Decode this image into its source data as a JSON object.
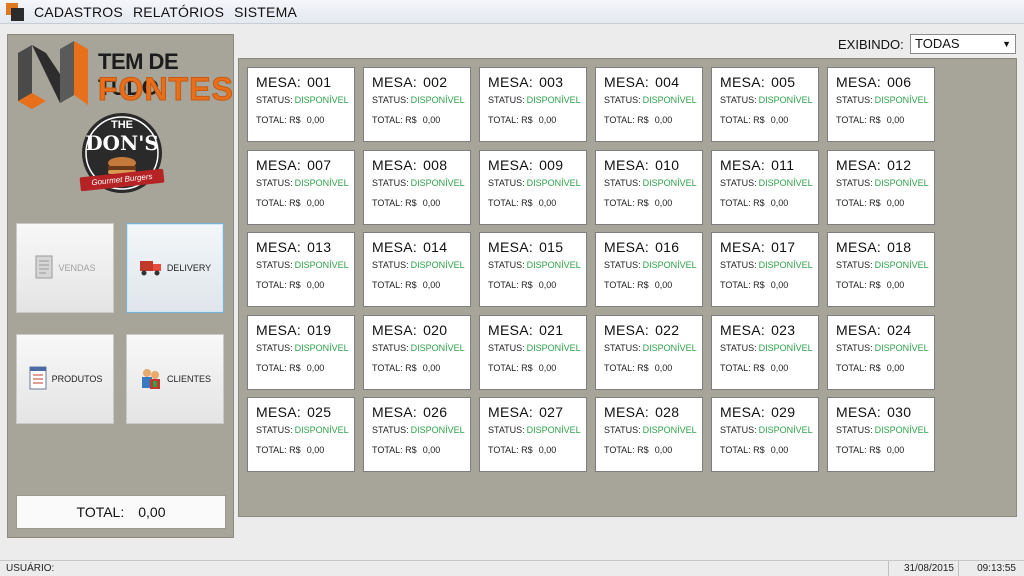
{
  "menu": {
    "items": [
      "CADASTROS",
      "RELATÓRIOS",
      "SISTEMA"
    ]
  },
  "brand": {
    "logo_line1": "TEM DE TUDO",
    "logo_line2": "FONTES",
    "badge_the": "THE",
    "badge_name": "DON'S",
    "badge_tagline": "Gourmet Burgers"
  },
  "sidebar": {
    "buttons": [
      {
        "label": "VENDAS",
        "icon": "document-icon",
        "state": "disabled"
      },
      {
        "label": "DELIVERY",
        "icon": "truck-icon",
        "state": "active"
      },
      {
        "label": "PRODUTOS",
        "icon": "list-icon",
        "state": "normal"
      },
      {
        "label": "CLIENTES",
        "icon": "people-icon",
        "state": "normal"
      }
    ],
    "total_label": "TOTAL:",
    "total_value": "0,00"
  },
  "filter": {
    "label": "EXIBINDO:",
    "selected": "TODAS"
  },
  "mesa_labels": {
    "prefix": "MESA:",
    "status_label": "STATUS:",
    "total_label": "TOTAL: R$"
  },
  "mesas": [
    {
      "numero": "001",
      "status": "DISPONÍVEL",
      "total": "0,00"
    },
    {
      "numero": "002",
      "status": "DISPONÍVEL",
      "total": "0,00"
    },
    {
      "numero": "003",
      "status": "DISPONÍVEL",
      "total": "0,00"
    },
    {
      "numero": "004",
      "status": "DISPONÍVEL",
      "total": "0,00"
    },
    {
      "numero": "005",
      "status": "DISPONÍVEL",
      "total": "0,00"
    },
    {
      "numero": "006",
      "status": "DISPONÍVEL",
      "total": "0,00"
    },
    {
      "numero": "007",
      "status": "DISPONÍVEL",
      "total": "0,00"
    },
    {
      "numero": "008",
      "status": "DISPONÍVEL",
      "total": "0,00"
    },
    {
      "numero": "009",
      "status": "DISPONÍVEL",
      "total": "0,00"
    },
    {
      "numero": "010",
      "status": "DISPONÍVEL",
      "total": "0,00"
    },
    {
      "numero": "011",
      "status": "DISPONÍVEL",
      "total": "0,00"
    },
    {
      "numero": "012",
      "status": "DISPONÍVEL",
      "total": "0,00"
    },
    {
      "numero": "013",
      "status": "DISPONÍVEL",
      "total": "0,00"
    },
    {
      "numero": "014",
      "status": "DISPONÍVEL",
      "total": "0,00"
    },
    {
      "numero": "015",
      "status": "DISPONÍVEL",
      "total": "0,00"
    },
    {
      "numero": "016",
      "status": "DISPONÍVEL",
      "total": "0,00"
    },
    {
      "numero": "017",
      "status": "DISPONÍVEL",
      "total": "0,00"
    },
    {
      "numero": "018",
      "status": "DISPONÍVEL",
      "total": "0,00"
    },
    {
      "numero": "019",
      "status": "DISPONÍVEL",
      "total": "0,00"
    },
    {
      "numero": "020",
      "status": "DISPONÍVEL",
      "total": "0,00"
    },
    {
      "numero": "021",
      "status": "DISPONÍVEL",
      "total": "0,00"
    },
    {
      "numero": "022",
      "status": "DISPONÍVEL",
      "total": "0,00"
    },
    {
      "numero": "023",
      "status": "DISPONÍVEL",
      "total": "0,00"
    },
    {
      "numero": "024",
      "status": "DISPONÍVEL",
      "total": "0,00"
    },
    {
      "numero": "025",
      "status": "DISPONÍVEL",
      "total": "0,00"
    },
    {
      "numero": "026",
      "status": "DISPONÍVEL",
      "total": "0,00"
    },
    {
      "numero": "027",
      "status": "DISPONÍVEL",
      "total": "0,00"
    },
    {
      "numero": "028",
      "status": "DISPONÍVEL",
      "total": "0,00"
    },
    {
      "numero": "029",
      "status": "DISPONÍVEL",
      "total": "0,00"
    },
    {
      "numero": "030",
      "status": "DISPONÍVEL",
      "total": "0,00"
    }
  ],
  "statusbar": {
    "user_label": "USUÁRIO:",
    "date": "31/08/2015",
    "time": "09:13:55"
  },
  "colors": {
    "panel_bg": "#a7a59a",
    "status_available": "#2fa24a",
    "brand_orange": "#e86f1c"
  }
}
